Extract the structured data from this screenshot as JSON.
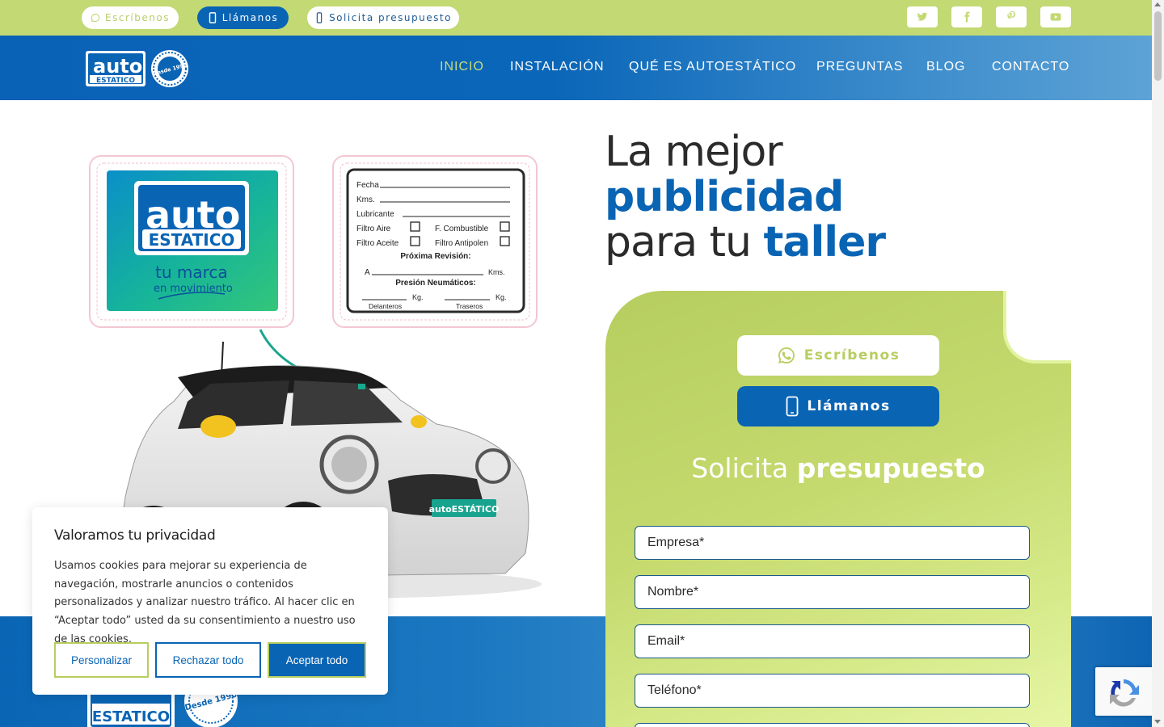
{
  "topbar": {
    "whatsapp_label": "Escríbenos",
    "call_label": "Llámanos",
    "quote_label": "Solicita presupuesto",
    "social": [
      {
        "icon": "twitter-icon"
      },
      {
        "icon": "facebook-icon"
      },
      {
        "icon": "pinterest-icon"
      },
      {
        "icon": "youtube-icon"
      }
    ]
  },
  "nav": {
    "items": [
      "INICIO",
      "INSTALACIÓN",
      "QUÉ ES AUTOESTÁTICO",
      "PREGUNTAS",
      "BLOG",
      "CONTACTO"
    ],
    "active": "INICIO"
  },
  "brand": {
    "logo_text_top": "auto",
    "logo_text_bottom": "ESTATICO",
    "seal_text": "Desde 1990"
  },
  "stickers": {
    "brand_tagline_1": "tu marca",
    "brand_tagline_2": "en movimiento",
    "card_fields": {
      "fecha": "Fecha",
      "kms": "Kms.",
      "lubricante": "Lubricante",
      "filtro_aire": "Filtro Aire",
      "f_combustible": "F. Combustible",
      "filtro_aceite": "Filtro Aceite",
      "filtro_antipolen": "Filtro Antipolen",
      "proxima_revision": "Próxima Revisión:",
      "a_label": "A",
      "kms_label": "Kms.",
      "presion": "Presión Neumáticos:",
      "kg1": "Kg.",
      "kg2": "Kg.",
      "delanteros": "Delanteros",
      "traseros": "Traseros"
    }
  },
  "hero": {
    "line1": "La mejor",
    "line2": "publicidad",
    "line3_a": "para tu",
    "line3_b": "taller"
  },
  "form": {
    "write_label": "Escríbenos",
    "call_label": "Llámanos",
    "title_a": "Solicita",
    "title_b": "presupuesto",
    "fields": [
      "Empresa*",
      "Nombre*",
      "Email*",
      "Teléfono*"
    ]
  },
  "cookie": {
    "title": "Valoramos tu privacidad",
    "body": "Usamos cookies para mejorar su experiencia de navegación, mostrarle anuncios o contenidos personalizados y analizar nuestro tráfico. Al hacer clic en “Aceptar todo” usted da su consentimiento a nuestro uso de las cookies.",
    "customize": "Personalizar",
    "reject": "Rechazar todo",
    "accept": "Aceptar todo"
  },
  "colors": {
    "lime": "#c2d974",
    "brand_blue": "#0a64b4",
    "active_nav": "#c9dd7c"
  }
}
